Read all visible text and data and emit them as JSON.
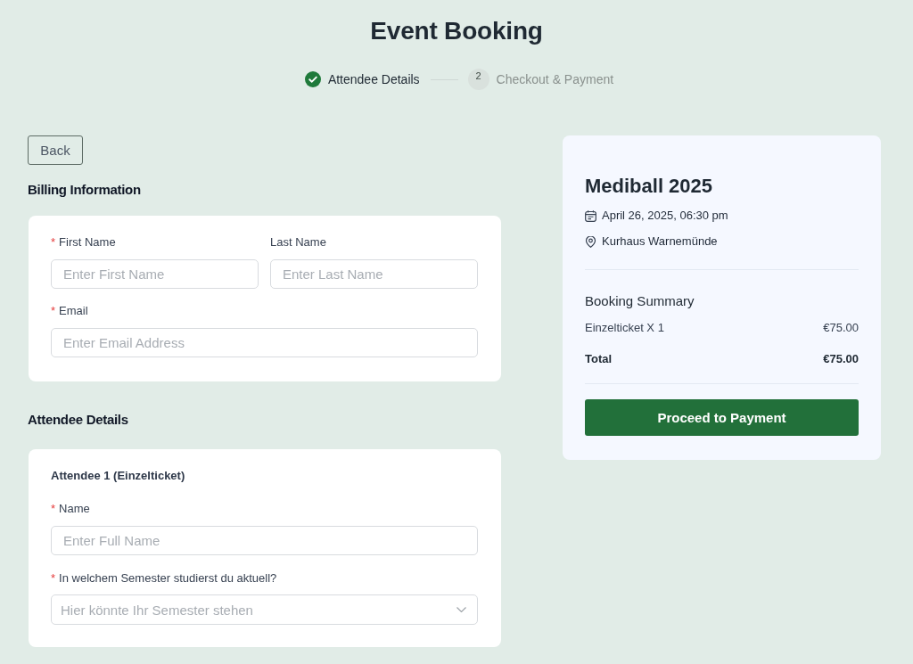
{
  "title": "Event Booking",
  "steps": [
    {
      "label": "Attendee Details",
      "completed": true
    },
    {
      "number": "2",
      "label": "Checkout & Payment",
      "completed": false
    }
  ],
  "back_button": "Back",
  "required_mark": "*",
  "billing": {
    "heading": "Billing Information",
    "rows": [
      [
        {
          "label": "First Name",
          "placeholder": "Enter First Name",
          "required": true
        },
        {
          "label": "Last Name",
          "placeholder": "Enter Last Name",
          "required": false
        }
      ],
      [
        {
          "label": "Email",
          "placeholder": "Enter Email Address",
          "required": true
        }
      ]
    ]
  },
  "attendee_section": {
    "heading": "Attendee Details",
    "attendees": [
      {
        "title": "Attendee 1 (Einzelticket)",
        "fields": [
          {
            "kind": "text",
            "label": "Name",
            "placeholder": "Enter Full Name",
            "required": true
          },
          {
            "kind": "select",
            "label": "In welchem Semester studierst du aktuell?",
            "placeholder": "Hier könnte Ihr Semester stehen",
            "required": true
          }
        ]
      }
    ]
  },
  "summary": {
    "event_title": "Mediball 2025",
    "date": "April 26, 2025, 06:30 pm",
    "location": "Kurhaus Warnemünde",
    "heading": "Booking Summary",
    "items": [
      {
        "name": "Einzelticket X 1",
        "price": "€75.00"
      }
    ],
    "total": {
      "label": "Total",
      "amount": "€75.00"
    },
    "button": "Proceed to Payment"
  }
}
